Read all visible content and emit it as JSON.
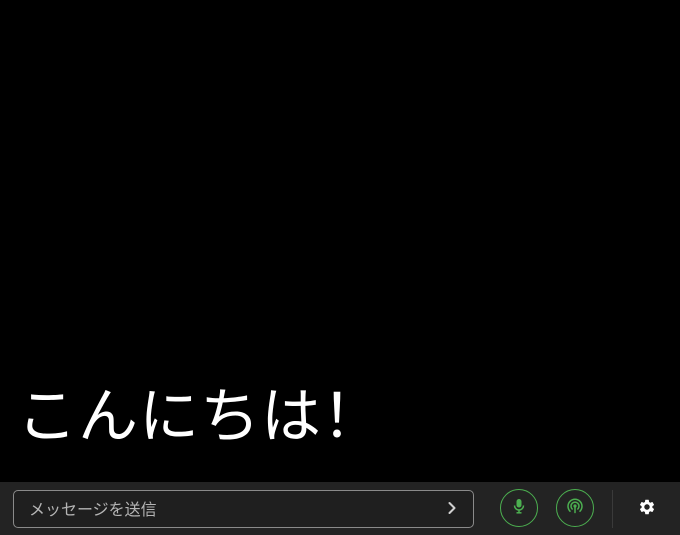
{
  "display": {
    "text": "こんにちは！"
  },
  "composer": {
    "input_value": "",
    "placeholder": "メッセージを送信",
    "send_icon": "chevron-right-icon"
  },
  "controls": {
    "mic_icon": "microphone-icon",
    "broadcast_icon": "broadcast-icon",
    "settings_icon": "gear-icon"
  },
  "colors": {
    "background": "#000000",
    "bar_background": "#232323",
    "accent": "#4caf50",
    "text": "#ffffff"
  }
}
